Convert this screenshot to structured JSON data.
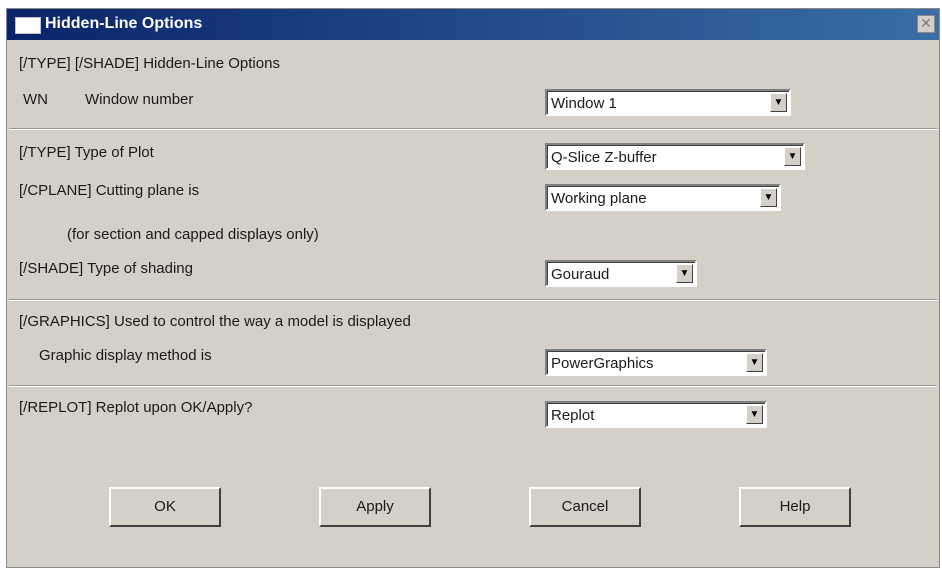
{
  "window": {
    "title": "Hidden-Line Options",
    "close_glyph": "✕"
  },
  "header": {
    "command_label": "[/TYPE] [/SHADE]  Hidden-Line Options"
  },
  "window_number": {
    "code": "WN",
    "label": "Window number",
    "value": "Window 1"
  },
  "type_of_plot": {
    "label": "[/TYPE]  Type of Plot",
    "value": "Q-Slice Z-buffer"
  },
  "cutting_plane": {
    "label": "[/CPLANE]  Cutting plane is",
    "value": "Working plane",
    "note": "(for section and capped displays only)"
  },
  "shading": {
    "label": "[/SHADE]  Type of shading",
    "value": "Gouraud"
  },
  "graphics": {
    "label": "[/GRAPHICS]  Used to control the way a model is displayed",
    "method_label": "Graphic display method is",
    "method_value": "PowerGraphics"
  },
  "replot": {
    "label": "[/REPLOT] Replot upon OK/Apply?",
    "value": "Replot"
  },
  "buttons": {
    "ok": "OK",
    "apply": "Apply",
    "cancel": "Cancel",
    "help": "Help"
  },
  "icons": {
    "dropdown_arrow": "▼",
    "dropdown_icon_name": "dropdown-arrow-icon",
    "close_icon_name": "close-icon"
  },
  "colors": {
    "titlebar_start": "#0a246a",
    "titlebar_end": "#3a6ea5",
    "dialog_face": "#d4d0c8"
  }
}
